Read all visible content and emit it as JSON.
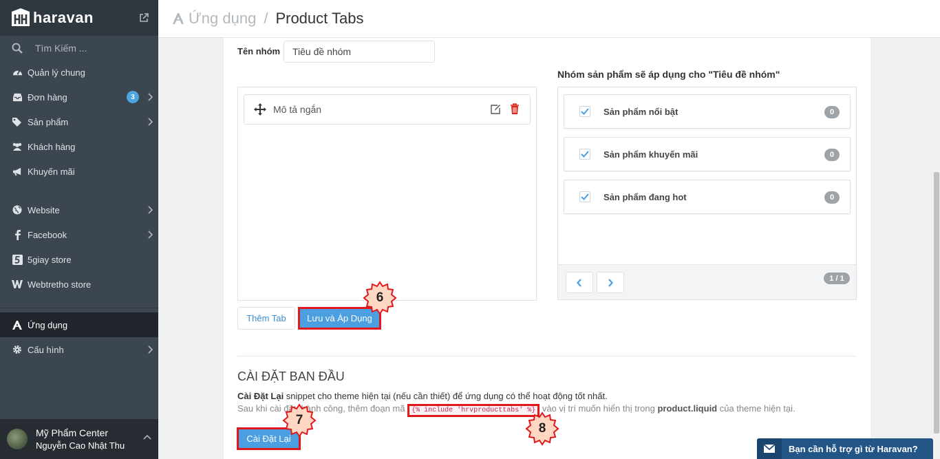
{
  "brand": {
    "name": "haravan"
  },
  "sidebar": {
    "search_placeholder": "Tìm Kiếm ...",
    "items": [
      {
        "label": "Quản lý chung",
        "icon": "dashboard-icon"
      },
      {
        "label": "Đơn hàng",
        "icon": "inbox-icon",
        "badge": "3"
      },
      {
        "label": "Sản phẩm",
        "icon": "tags-icon"
      },
      {
        "label": "Khách hàng",
        "icon": "users-icon"
      },
      {
        "label": "Khuyến mãi",
        "icon": "bullhorn-icon"
      },
      {
        "label": "Website",
        "icon": "globe-icon"
      },
      {
        "label": "Facebook",
        "icon": "facebook-icon"
      },
      {
        "label": "5giay store",
        "icon": "5giay-icon"
      },
      {
        "label": "Webtretho store",
        "icon": "webtretho-icon"
      },
      {
        "label": "Ứng dụng",
        "icon": "apps-icon"
      },
      {
        "label": "Cấu hình",
        "icon": "gear-icon"
      }
    ],
    "user": {
      "store": "Mỹ Phẩm Center",
      "name": "Nguyễn Cao Nhật Thu"
    }
  },
  "header": {
    "parent": "Ứng dụng",
    "separator": "/",
    "current": "Product Tabs"
  },
  "form": {
    "group_label": "Tên nhóm",
    "group_value": "Tiêu đề nhóm",
    "tabs": [
      {
        "label": "Mô tả ngắn"
      }
    ],
    "add_tab_label": "Thêm Tab",
    "save_label": "Lưu và Áp Dụng"
  },
  "groups": {
    "title": "Nhóm sản phẩm sẽ áp dụng cho \"Tiêu đề nhóm\"",
    "items": [
      {
        "name": "Sản phẩm nổi bật",
        "count": "0",
        "checked": true
      },
      {
        "name": "Sản phẩm khuyến mãi",
        "count": "0",
        "checked": true
      },
      {
        "name": "Sản phẩm đang hot",
        "count": "0",
        "checked": true
      }
    ],
    "page_info": "1 / 1"
  },
  "setup": {
    "title": "CÀI ĐẶT BAN ĐẦU",
    "line1_bold": "Cài Đặt Lại",
    "line1_rest": " snippet cho theme hiện tại (nếu cần thiết) để ứng dụng có thể hoạt động tốt nhất.",
    "line2_a": "Sau khi cài đặt thành công, thêm đoạn mã ",
    "code": "{% include 'hrvproducttabs' %}",
    "line2_b": " vào vị trí muốn hiển thị trong ",
    "line2_file": "product.liquid",
    "line2_c": " của theme hiện tại.",
    "reset_label": "Cài Đặt Lại"
  },
  "annotations": {
    "step6": "6",
    "step7": "7",
    "step8": "8"
  },
  "support": {
    "label": "Bạn cần hỗ trợ gì từ Haravan?"
  },
  "colors": {
    "primary": "#4b9ee0",
    "sidebar": "#3c4650",
    "highlight": "#e0181c",
    "badge_star": "#ffd7c2"
  }
}
